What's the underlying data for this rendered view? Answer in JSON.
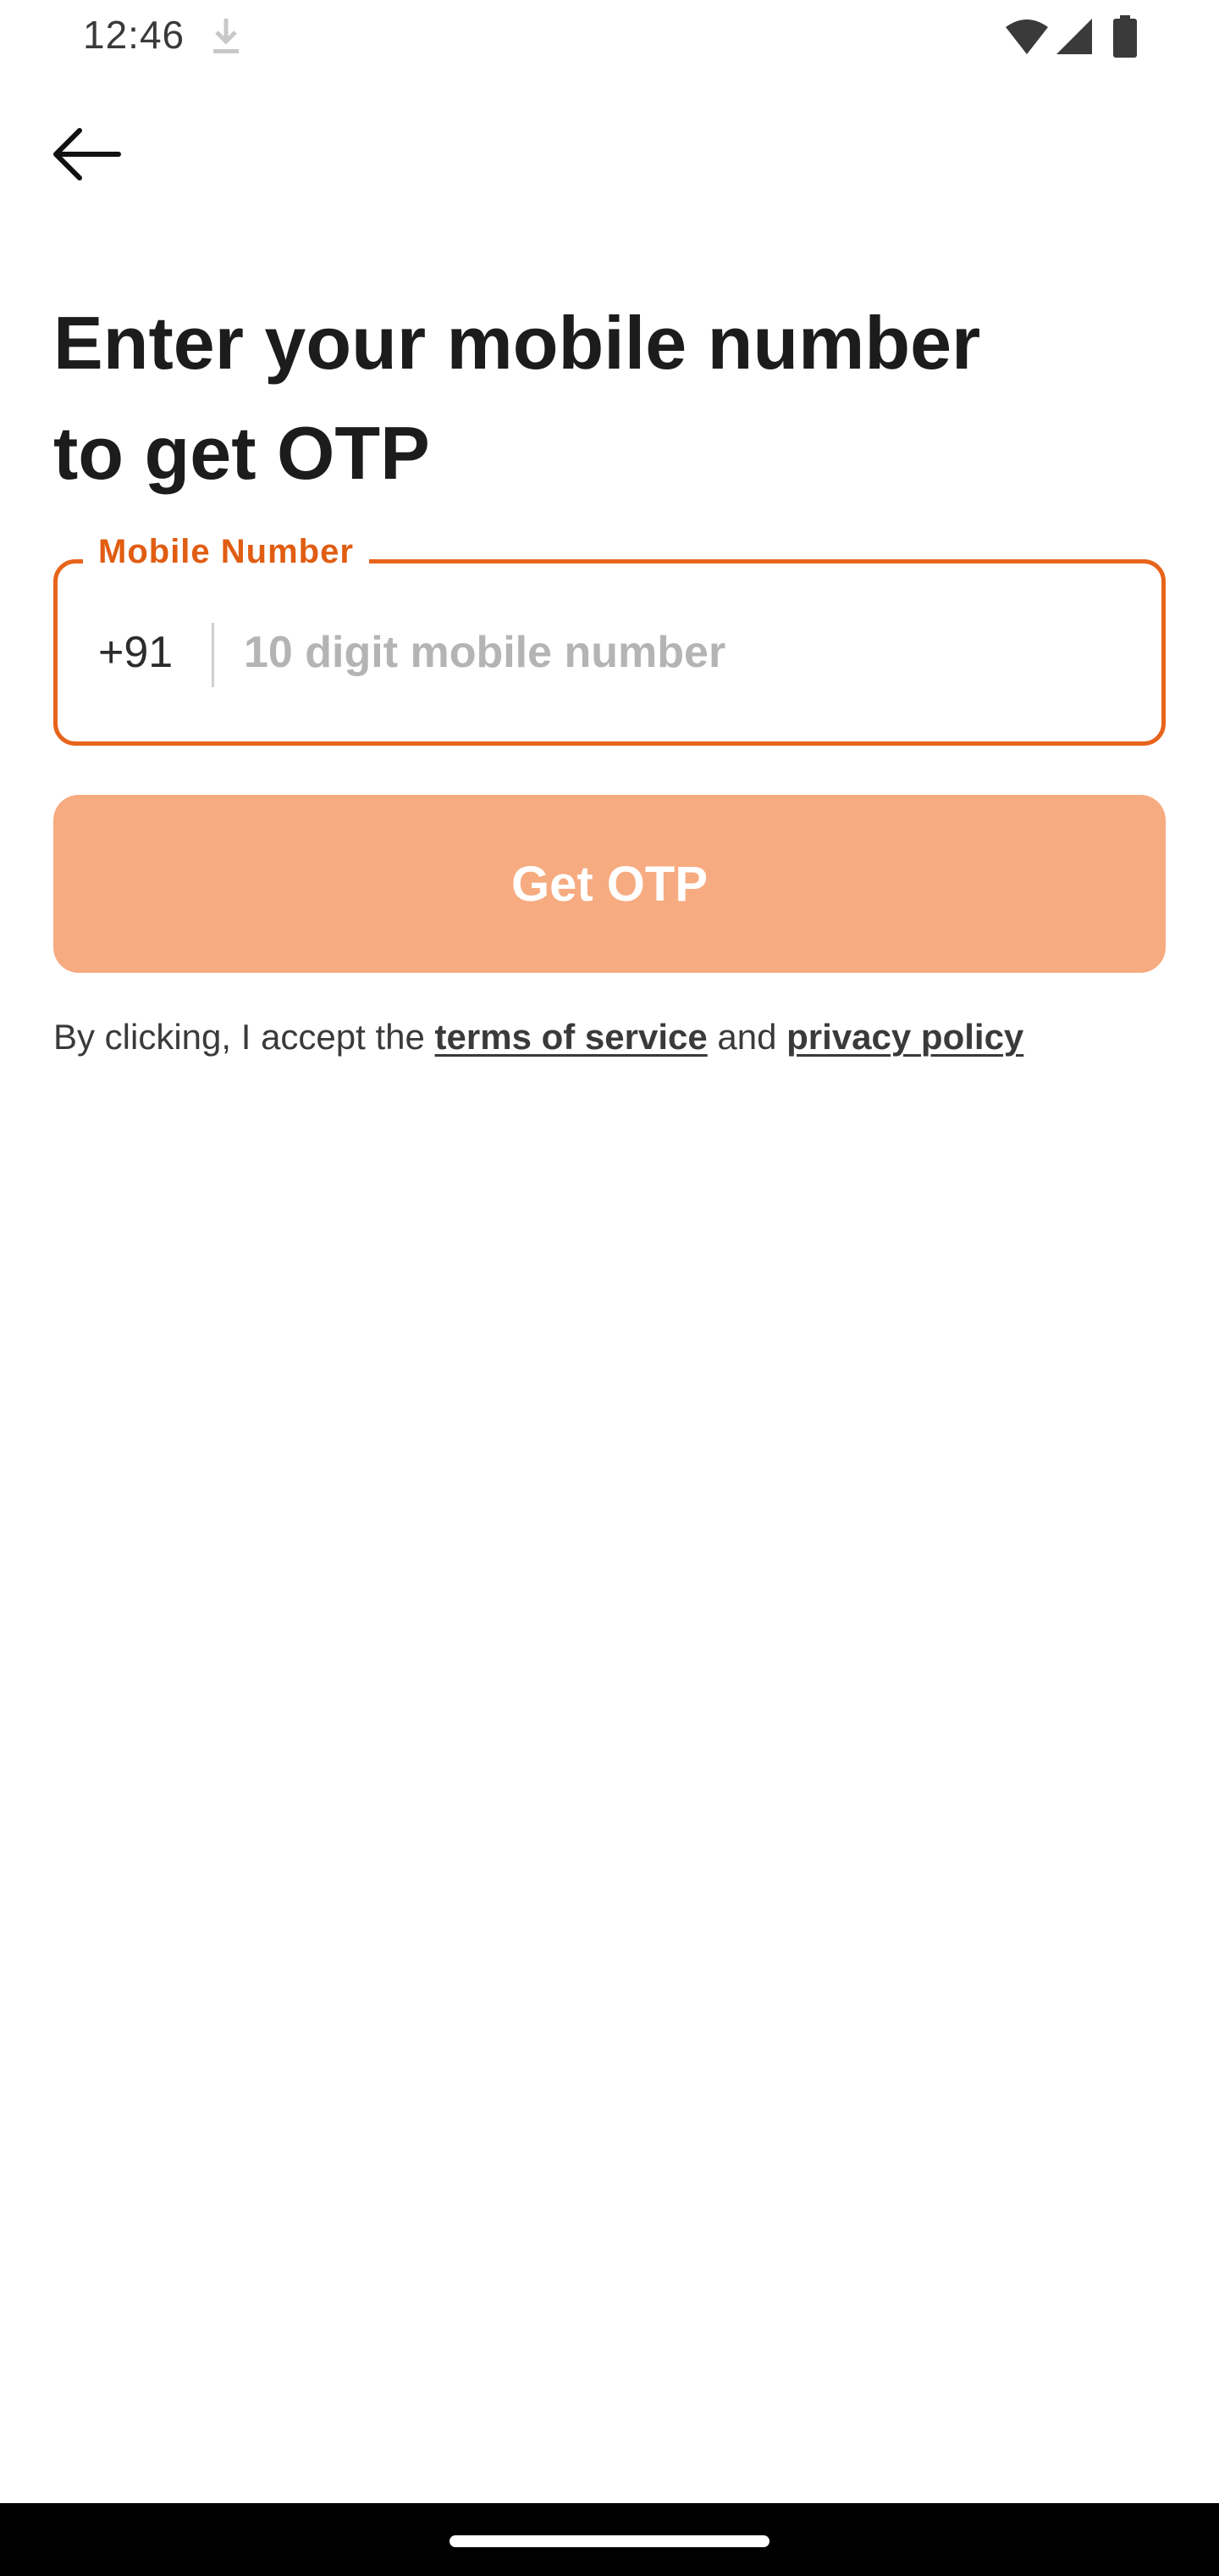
{
  "status_bar": {
    "time": "12:46",
    "icons": [
      "download-icon",
      "wifi-icon",
      "signal-icon",
      "battery-icon"
    ]
  },
  "header": {
    "back_icon": "back-arrow-icon"
  },
  "main": {
    "headline": "Enter your mobile number to get OTP",
    "mobile_field": {
      "label": "Mobile Number",
      "country_code": "+91",
      "value": "",
      "placeholder": "10 digit mobile number"
    },
    "otp_button_label": "Get OTP",
    "terms": {
      "prefix": "By clicking, I accept the ",
      "terms_link": "terms of service",
      "middle": " and ",
      "privacy_link": "privacy policy"
    }
  },
  "colors": {
    "accent": "#e8641b",
    "label": "#e05d12",
    "button_disabled": "#f7ab80",
    "text": "#1c1c1c"
  }
}
